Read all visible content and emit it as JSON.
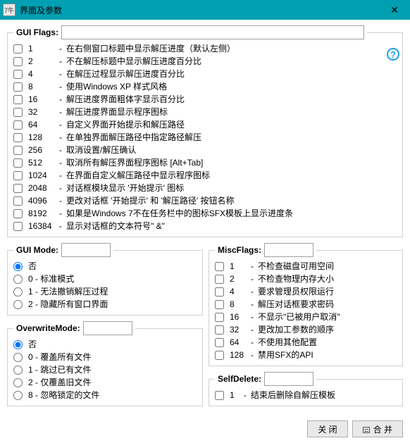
{
  "window": {
    "icon_text": "7牛",
    "title": "界面及参数",
    "close_glyph": "✕"
  },
  "guiFlags": {
    "legend": "GUI Flags:",
    "value": "",
    "help_glyph": "?",
    "items": [
      {
        "n": "1",
        "label": "在右侧窗口标题中显示解压进度（默认左侧）"
      },
      {
        "n": "2",
        "label": "不在解压标题中显示解压进度百分比"
      },
      {
        "n": "4",
        "label": "在解压过程显示解压进度百分比"
      },
      {
        "n": "8",
        "label": "使用Windows XP 样式风格"
      },
      {
        "n": "16",
        "label": "解压进度界面粗体字显示百分比"
      },
      {
        "n": "32",
        "label": "解压进度界面显示程序图标"
      },
      {
        "n": "64",
        "label": "自定义界面开始提示和解压路径"
      },
      {
        "n": "128",
        "label": "在单独界面解压路径中指定路径解压"
      },
      {
        "n": "256",
        "label": "取消设置/解压确认"
      },
      {
        "n": "512",
        "label": "取消所有解压界面程序图标 [Alt+Tab]"
      },
      {
        "n": "1024",
        "label": "在界面自定义解压路径中显示程序图标"
      },
      {
        "n": "2048",
        "label": "对话框模块显示 '开始提示' 图标"
      },
      {
        "n": "4096",
        "label": "更改对话框 '开始提示' 和 '解压路径' 按钮名称"
      },
      {
        "n": "8192",
        "label": "如果是Windows 7不在任务栏中的图标SFX模板上显示进度条"
      },
      {
        "n": "16384",
        "label": "显示对话框的文本符号\" &\""
      }
    ]
  },
  "guiMode": {
    "legend": "GUI Mode:",
    "value": "",
    "selected": 0,
    "items": [
      {
        "label": "否"
      },
      {
        "label": "0 - 标准模式"
      },
      {
        "label": "1 - 无法撤销解压过程"
      },
      {
        "label": "2 - 隐藏所有窗口界面"
      }
    ]
  },
  "overwriteMode": {
    "legend": "OverwriteMode:",
    "value": "",
    "selected": 0,
    "items": [
      {
        "label": "否"
      },
      {
        "label": "0 - 覆盖所有文件"
      },
      {
        "label": "1 - 跳过已有文件"
      },
      {
        "label": "2 - 仅覆盖旧文件"
      },
      {
        "label": "8 - 忽略锁定的文件"
      }
    ]
  },
  "miscFlags": {
    "legend": "MiscFlags:",
    "value": "",
    "items": [
      {
        "n": "1",
        "label": "不检查磁盘可用空间"
      },
      {
        "n": "2",
        "label": "不检查物理内存大小"
      },
      {
        "n": "4",
        "label": "要求管理员权限运行"
      },
      {
        "n": "8",
        "label": "解压对话框要求密码"
      },
      {
        "n": "16",
        "label": "不显示\"已被用户取消\""
      },
      {
        "n": "32",
        "label": "更改加工参数的顺序"
      },
      {
        "n": "64",
        "label": "不使用其他配置"
      },
      {
        "n": "128",
        "label": "禁用SFX的API"
      }
    ]
  },
  "selfDelete": {
    "legend": "SelfDelete:",
    "value": "",
    "items": [
      {
        "n": "1",
        "label": "结束后删除自解压模板"
      }
    ]
  },
  "buttons": {
    "close": "关 闭",
    "combine": "合 并"
  }
}
